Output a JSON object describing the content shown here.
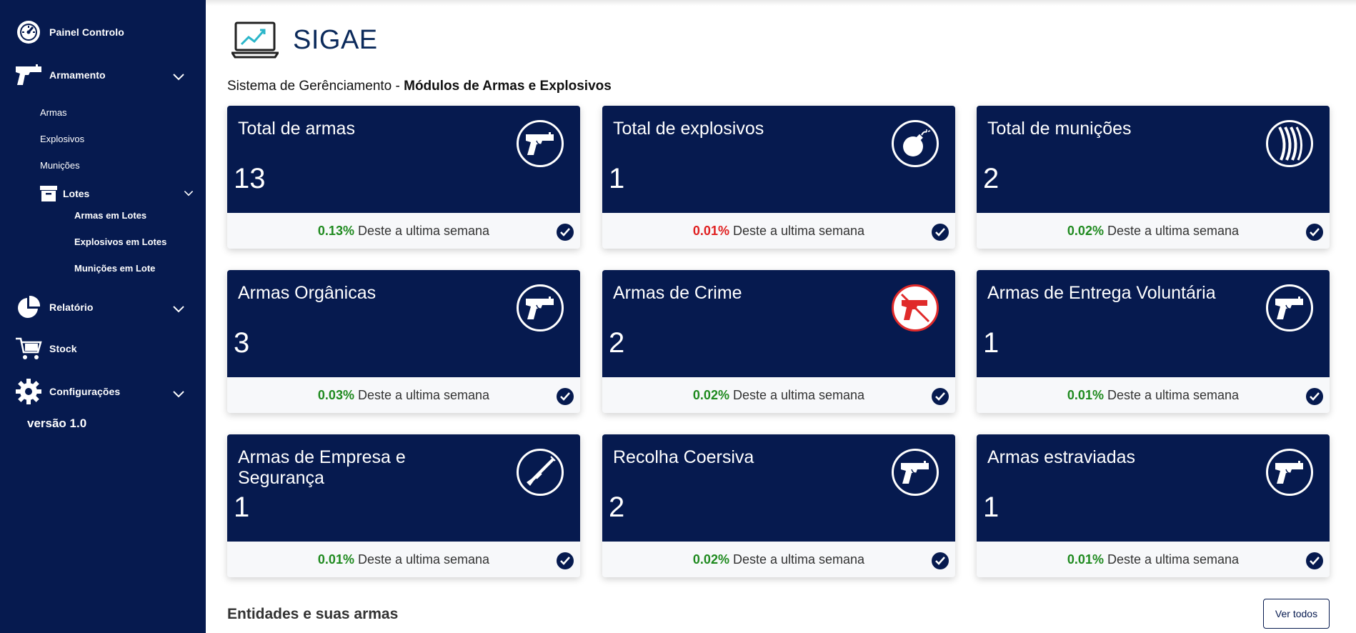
{
  "sidebar": {
    "items": [
      {
        "label": "Painel Controlo",
        "icon": "speedometer-icon"
      },
      {
        "label": "Armamento",
        "icon": "pistol-icon"
      },
      {
        "label": "Relatório",
        "icon": "pie-chart-icon"
      },
      {
        "label": "Stock",
        "icon": "cart-icon"
      },
      {
        "label": "Configurações",
        "icon": "gear-icon"
      }
    ],
    "armamento_sub": [
      "Armas",
      "Explosivos",
      "Munições"
    ],
    "lotes": {
      "label": "Lotes",
      "icon": "archive-box-icon",
      "items": [
        "Armas em Lotes",
        "Explosivos em Lotes",
        "Munições em Lote"
      ]
    },
    "version": "versão 1.0"
  },
  "header": {
    "brand": "SIGAE",
    "subtitle_prefix": "Sistema de Gerênciamento - ",
    "subtitle_bold": "Módulos de Armas e Explosivos"
  },
  "cards": [
    {
      "title": "Total de armas",
      "value": "13",
      "pct": "0.13%",
      "trend": "positive",
      "foot": "Deste a ultima semana",
      "icon": "pistol-icon"
    },
    {
      "title": "Total de explosivos",
      "value": "1",
      "pct": "0.01%",
      "trend": "negative",
      "foot": "Deste a ultima semana",
      "icon": "bomb-icon"
    },
    {
      "title": "Total de munições",
      "value": "2",
      "pct": "0.02%",
      "trend": "positive",
      "foot": "Deste a ultima semana",
      "icon": "ammo-magazine-icon"
    },
    {
      "title": "Armas Orgânicas",
      "value": "3",
      "pct": "0.03%",
      "trend": "positive",
      "foot": "Deste a ultima semana",
      "icon": "pistol-icon"
    },
    {
      "title": "Armas de Crime",
      "value": "2",
      "pct": "0.02%",
      "trend": "positive",
      "foot": "Deste a ultima semana",
      "icon": "no-guns-icon"
    },
    {
      "title": "Armas de Entrega Voluntária",
      "value": "1",
      "pct": "0.01%",
      "trend": "positive",
      "foot": "Deste a ultima semana",
      "icon": "pistol-icon"
    },
    {
      "title": "Armas de Empresa e Segurança",
      "value": "1",
      "pct": "0.01%",
      "trend": "positive",
      "foot": "Deste a ultima semana",
      "icon": "rifle-icon"
    },
    {
      "title": "Recolha Coersiva",
      "value": "2",
      "pct": "0.02%",
      "trend": "positive",
      "foot": "Deste a ultima semana",
      "icon": "pistol-icon"
    },
    {
      "title": "Armas estraviadas",
      "value": "1",
      "pct": "0.01%",
      "trend": "positive",
      "foot": "Deste a ultima semana",
      "icon": "pistol-icon"
    }
  ],
  "section": {
    "title": "Entidades e suas armas",
    "button": "Ver todos"
  },
  "colors": {
    "navy": "#061a4f",
    "positive": "#1f8a1f",
    "negative": "#e02020",
    "crime_icon": "#e02a2a"
  }
}
